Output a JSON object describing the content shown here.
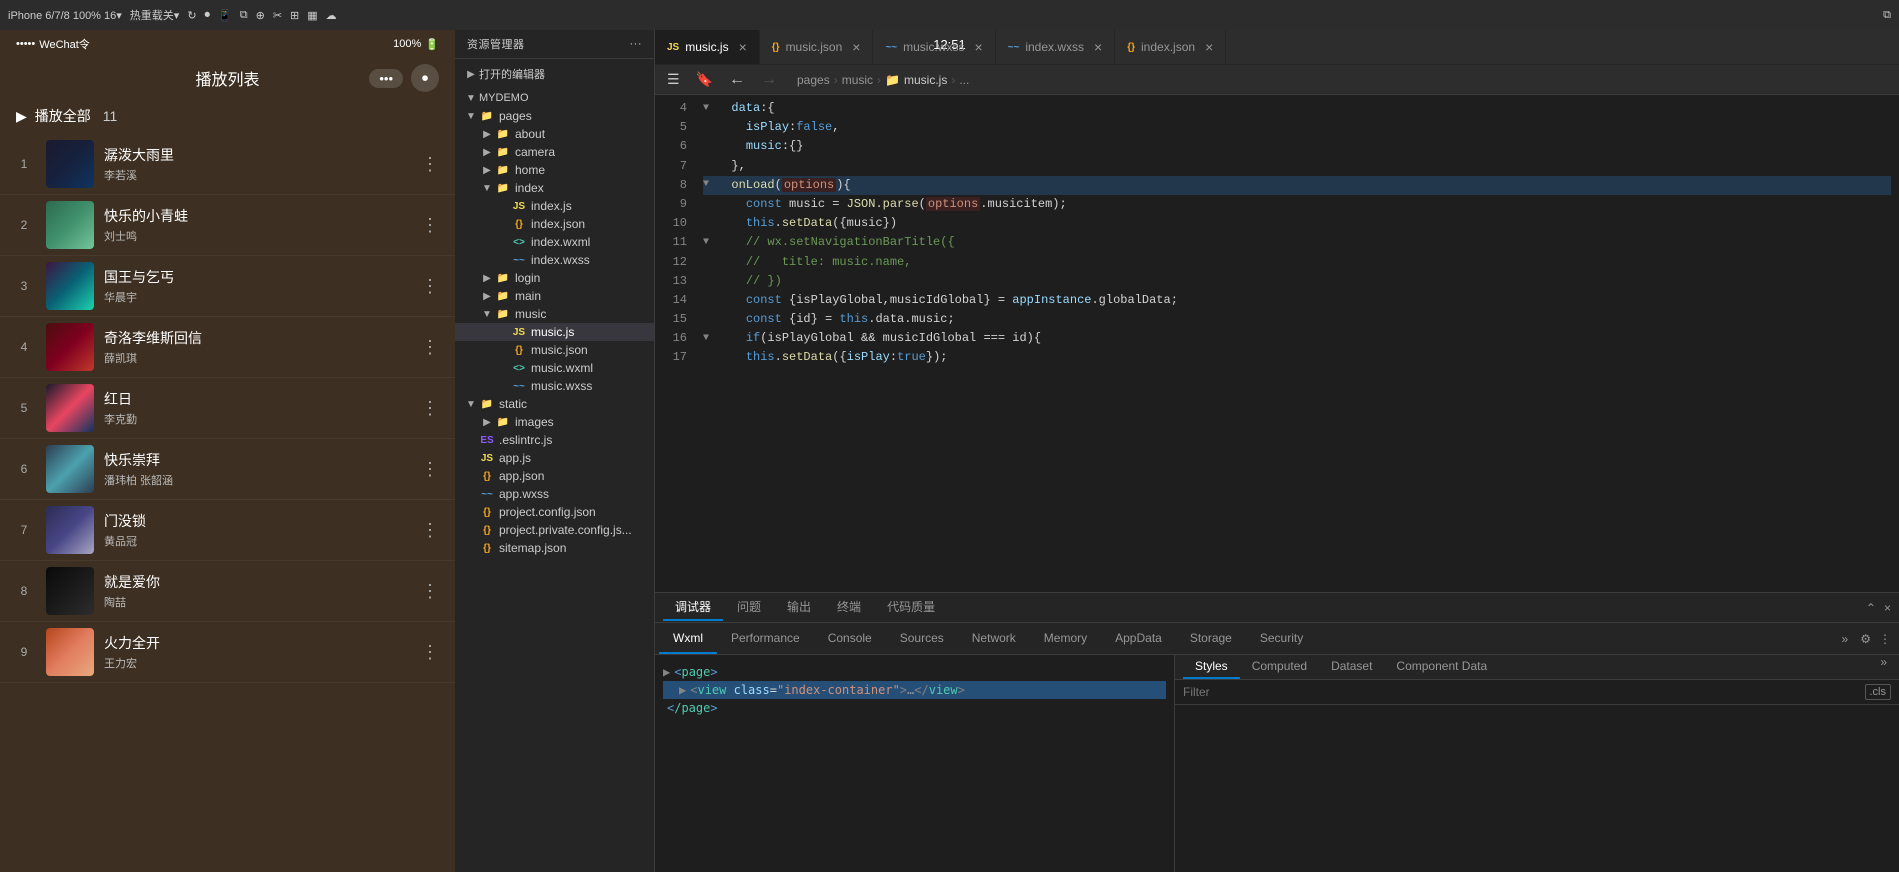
{
  "topbar": {
    "device_label": "iPhone 6/7/8 100% 16▾",
    "hot_reload": "热重载关▾",
    "tabs_label": "music.js",
    "file_tabs": [
      {
        "id": "music-js",
        "label": "music.js",
        "type": "js",
        "active": true
      },
      {
        "id": "music-json",
        "label": "music.json",
        "type": "json",
        "active": false
      },
      {
        "id": "music-wxss",
        "label": "music.wxss",
        "type": "wxss",
        "active": false
      },
      {
        "id": "index-wxss",
        "label": "index.wxss",
        "type": "wxss",
        "active": false
      },
      {
        "id": "index-json",
        "label": "index.json",
        "type": "json",
        "active": false
      }
    ],
    "options_label": "options"
  },
  "toolbar": {
    "menu_icon": "☰",
    "bookmark_icon": "🔖",
    "back_icon": "←",
    "forward_icon": "→",
    "breadcrumb": [
      "pages",
      "music",
      "music.js",
      "..."
    ]
  },
  "file_explorer": {
    "header": "资源管理器",
    "sections": {
      "open_editors": "打开的编辑器",
      "project": "MYDEMO"
    },
    "tree": [
      {
        "id": "pages",
        "label": "pages",
        "type": "folder",
        "level": 1,
        "open": true
      },
      {
        "id": "about",
        "label": "about",
        "type": "folder",
        "level": 2,
        "open": false
      },
      {
        "id": "camera",
        "label": "camera",
        "type": "folder",
        "level": 2,
        "open": false
      },
      {
        "id": "home",
        "label": "home",
        "type": "folder",
        "level": 2,
        "open": false
      },
      {
        "id": "index",
        "label": "index",
        "type": "folder",
        "level": 2,
        "open": true
      },
      {
        "id": "index-js",
        "label": "index.js",
        "type": "js",
        "level": 3
      },
      {
        "id": "index-json",
        "label": "index.json",
        "type": "json",
        "level": 3
      },
      {
        "id": "index-wxml",
        "label": "index.wxml",
        "type": "wxml",
        "level": 3
      },
      {
        "id": "index-wxss",
        "label": "index.wxss",
        "type": "wxss",
        "level": 3
      },
      {
        "id": "login",
        "label": "login",
        "type": "folder",
        "level": 2,
        "open": false
      },
      {
        "id": "main",
        "label": "main",
        "type": "folder",
        "level": 2,
        "open": false
      },
      {
        "id": "music",
        "label": "music",
        "type": "folder-red",
        "level": 2,
        "open": true
      },
      {
        "id": "music-js",
        "label": "music.js",
        "type": "js-yellow",
        "level": 3,
        "active": true
      },
      {
        "id": "music-json",
        "label": "music.json",
        "type": "json",
        "level": 3
      },
      {
        "id": "music-wxml",
        "label": "music.wxml",
        "type": "wxml",
        "level": 3
      },
      {
        "id": "music-wxss-file",
        "label": "music.wxss",
        "type": "wxss",
        "level": 3
      },
      {
        "id": "static",
        "label": "static",
        "type": "folder",
        "level": 1,
        "open": true
      },
      {
        "id": "images",
        "label": "images",
        "type": "folder",
        "level": 2,
        "open": false
      },
      {
        "id": "eslintrc",
        "label": ".eslintrc.js",
        "type": "eslint",
        "level": 1
      },
      {
        "id": "app-js",
        "label": "app.js",
        "type": "js",
        "level": 1
      },
      {
        "id": "app-json",
        "label": "app.json",
        "type": "json",
        "level": 1
      },
      {
        "id": "app-wxss",
        "label": "app.wxss",
        "type": "wxss",
        "level": 1
      },
      {
        "id": "project-config",
        "label": "project.config.json",
        "type": "json",
        "level": 1
      },
      {
        "id": "project-private",
        "label": "project.private.config.js...",
        "type": "json",
        "level": 1
      },
      {
        "id": "sitemap",
        "label": "sitemap.json",
        "type": "json",
        "level": 1
      }
    ]
  },
  "code_editor": {
    "lines": [
      {
        "num": 4,
        "indent": "  ",
        "content": "data:{",
        "fold": true
      },
      {
        "num": 5,
        "indent": "    ",
        "content": "isPlay:false,"
      },
      {
        "num": 6,
        "indent": "    ",
        "content": "music:{}"
      },
      {
        "num": 7,
        "indent": "  ",
        "content": "},"
      },
      {
        "num": 8,
        "indent": "  ",
        "content": "onLoad(options){",
        "fold": true
      },
      {
        "num": 9,
        "indent": "    ",
        "content": "const music = JSON.parse(options.musicitem);"
      },
      {
        "num": 10,
        "indent": "    ",
        "content": "this.setData({music})"
      },
      {
        "num": 11,
        "indent": "    ",
        "content": "// wx.setNavigationBarTitle({",
        "fold": true
      },
      {
        "num": 12,
        "indent": "    ",
        "content": "//   title: music.name,"
      },
      {
        "num": 13,
        "indent": "    ",
        "content": "// })"
      },
      {
        "num": 14,
        "indent": "    ",
        "content": "const {isPlayGlobal,musicIdGlobal} = appInstance.globalData;"
      },
      {
        "num": 15,
        "indent": "    ",
        "content": "const {id} = this.data.music;"
      },
      {
        "num": 16,
        "indent": "    ",
        "content": "if(isPlayGlobal && musicIdGlobal === id){",
        "fold": true
      },
      {
        "num": 17,
        "indent": "    ",
        "content": "this.setData({isPlay:true});"
      }
    ]
  },
  "phone": {
    "status": {
      "signal": "•••••",
      "carrier": "WeChat令",
      "time": "12:51",
      "battery": "100%"
    },
    "title": "播放列表",
    "play_all_label": "播放全部",
    "song_count": "11",
    "songs": [
      {
        "num": "1",
        "title": "潺泼大雨里",
        "artist": "李若溪",
        "thumb_class": "thumb-gradient-1"
      },
      {
        "num": "2",
        "title": "快乐的小青蛙",
        "artist": "刘士鸣",
        "thumb_class": "thumb-gradient-2"
      },
      {
        "num": "3",
        "title": "国王与乞丐",
        "artist": "华晨宇",
        "thumb_class": "thumb-gradient-3"
      },
      {
        "num": "4",
        "title": "奇洛李维斯回信",
        "artist": "薛凯琪",
        "thumb_class": "thumb-gradient-4"
      },
      {
        "num": "5",
        "title": "红日",
        "artist": "李克勤",
        "thumb_class": "thumb-gradient-5"
      },
      {
        "num": "6",
        "title": "快乐崇拜",
        "artist": "潘玮柏 张韶涵",
        "thumb_class": "thumb-gradient-6"
      },
      {
        "num": "7",
        "title": "门没锁",
        "artist": "黄品冠",
        "thumb_class": "thumb-gradient-7"
      },
      {
        "num": "8",
        "title": "就是爱你",
        "artist": "陶喆",
        "thumb_class": "thumb-gradient-8"
      },
      {
        "num": "9",
        "title": "火力全开",
        "artist": "王力宏",
        "thumb_class": "thumb-gradient-9"
      }
    ]
  },
  "bottom_panel": {
    "tabs": [
      "调试器",
      "问题",
      "输出",
      "终端",
      "代码质量"
    ],
    "active_tab": "调试器"
  },
  "devtools": {
    "tabs": [
      "Wxml",
      "Performance",
      "Console",
      "Sources",
      "Network",
      "Memory",
      "AppData",
      "Storage",
      "Security"
    ],
    "active_tab": "Wxml",
    "dom": {
      "page_tag": "<page>",
      "view_tag": "<view class=\"index-container\">…</view>",
      "page_close": "</page>"
    },
    "styles_tabs": [
      "Styles",
      "Computed",
      "Dataset",
      "Component Data"
    ],
    "active_styles_tab": "Styles",
    "filter_placeholder": "Filter",
    "filter_cls": ".cls"
  }
}
